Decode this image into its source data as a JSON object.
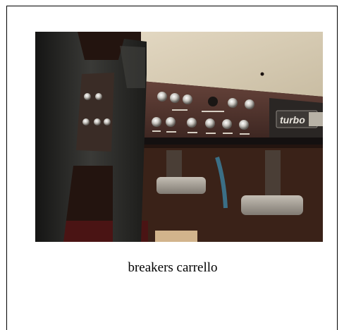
{
  "figure": {
    "caption": "breakers carrello",
    "photo_subject": "aircraft-panel-circuit-breakers-photo",
    "panel_brand": "turbo"
  },
  "colors": {
    "panel_cream": "#d8cdb6",
    "panel_brown": "#5a3a32",
    "yoke_dark": "#252523",
    "pedal_grey": "#a8a29a",
    "floor_dark": "#23140f"
  }
}
